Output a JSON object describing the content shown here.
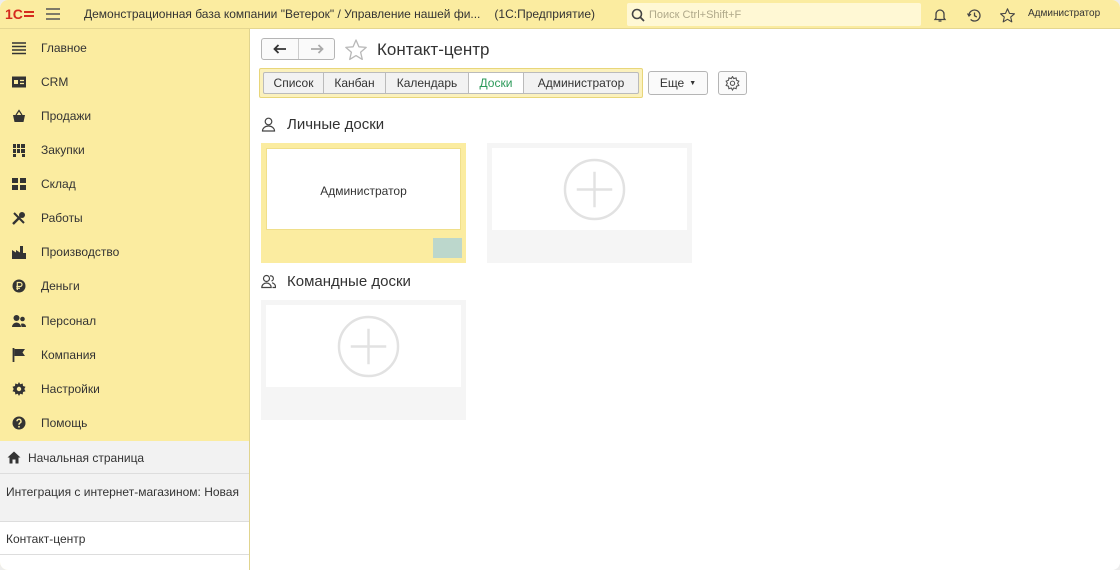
{
  "app": {
    "title": "Демонстрационная база компании \"Ветерок\" / Управление нашей фи...",
    "platform": "(1С:Предприятие)",
    "search_placeholder": "Поиск Ctrl+Shift+F",
    "user": "Администратор",
    "accent_color": "#fbeca0",
    "logo": "1c-logo"
  },
  "sidebar": {
    "items": [
      {
        "label": "Главное",
        "icon": "menu-lines-icon"
      },
      {
        "label": "CRM",
        "icon": "crm-card-icon"
      },
      {
        "label": "Продажи",
        "icon": "basket-icon"
      },
      {
        "label": "Закупки",
        "icon": "cart-icon"
      },
      {
        "label": "Склад",
        "icon": "warehouse-grid-icon"
      },
      {
        "label": "Работы",
        "icon": "tools-icon"
      },
      {
        "label": "Производство",
        "icon": "factory-icon"
      },
      {
        "label": "Деньги",
        "icon": "ruble-coin-icon"
      },
      {
        "label": "Персонал",
        "icon": "people-icon"
      },
      {
        "label": "Компания",
        "icon": "flag-icon"
      },
      {
        "label": "Настройки",
        "icon": "gear-icon"
      },
      {
        "label": "Помощь",
        "icon": "help-icon"
      }
    ]
  },
  "open_windows": {
    "home": "Начальная страница",
    "integration": "Интеграция с интернет-магазином: Новая",
    "contact_center": "Контакт-центр"
  },
  "page": {
    "title": "Контакт-центр",
    "tabs": [
      {
        "label": "Список",
        "active": false
      },
      {
        "label": "Канбан",
        "active": false
      },
      {
        "label": "Календарь",
        "active": false
      },
      {
        "label": "Доски",
        "active": true
      },
      {
        "label": "Администратор",
        "active": false
      }
    ],
    "more_label": "Еще",
    "personal_section": "Личные доски",
    "team_section": "Командные доски",
    "personal_board_name": "Администратор",
    "active_tab_color": "#2c9a5a"
  }
}
